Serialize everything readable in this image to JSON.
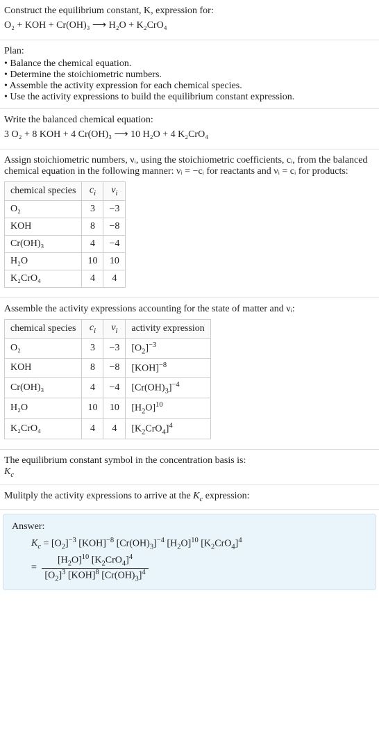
{
  "intro": {
    "line1": "Construct the equilibrium constant, K, expression for:",
    "equation": "O₂ + KOH + Cr(OH)₃ ⟶ H₂O + K₂CrO₄"
  },
  "plan": {
    "heading": "Plan:",
    "items": [
      "Balance the chemical equation.",
      "Determine the stoichiometric numbers.",
      "Assemble the activity expression for each chemical species.",
      "Use the activity expressions to build the equilibrium constant expression."
    ]
  },
  "balanced": {
    "heading": "Write the balanced chemical equation:",
    "equation": "3 O₂ + 8 KOH + 4 Cr(OH)₃ ⟶ 10 H₂O + 4 K₂CrO₄"
  },
  "stoich_intro": "Assign stoichiometric numbers, νᵢ, using the stoichiometric coefficients, cᵢ, from the balanced chemical equation in the following manner: νᵢ = −cᵢ for reactants and νᵢ = cᵢ for products:",
  "table1": {
    "headers": [
      "chemical species",
      "cᵢ",
      "νᵢ"
    ],
    "rows": [
      [
        "O₂",
        "3",
        "−3"
      ],
      [
        "KOH",
        "8",
        "−8"
      ],
      [
        "Cr(OH)₃",
        "4",
        "−4"
      ],
      [
        "H₂O",
        "10",
        "10"
      ],
      [
        "K₂CrO₄",
        "4",
        "4"
      ]
    ]
  },
  "activity_intro": "Assemble the activity expressions accounting for the state of matter and νᵢ:",
  "table2": {
    "headers": [
      "chemical species",
      "cᵢ",
      "νᵢ",
      "activity expression"
    ],
    "species": [
      "O₂",
      "KOH",
      "Cr(OH)₃",
      "H₂O",
      "K₂CrO₄"
    ],
    "ci": [
      "3",
      "8",
      "4",
      "10",
      "4"
    ],
    "vi": [
      "−3",
      "−8",
      "−4",
      "10",
      "4"
    ]
  },
  "symbol": {
    "line1": "The equilibrium constant symbol in the concentration basis is:",
    "line2": "K_c"
  },
  "multiply": "Mulitply the activity expressions to arrive at the K_c expression:",
  "answer": {
    "label": "Answer:"
  },
  "chart_data": {
    "type": "table",
    "tables": [
      {
        "title": "Stoichiometric numbers",
        "columns": [
          "chemical species",
          "c_i",
          "ν_i"
        ],
        "rows": [
          {
            "chemical species": "O₂",
            "c_i": 3,
            "ν_i": -3
          },
          {
            "chemical species": "KOH",
            "c_i": 8,
            "ν_i": -8
          },
          {
            "chemical species": "Cr(OH)₃",
            "c_i": 4,
            "ν_i": -4
          },
          {
            "chemical species": "H₂O",
            "c_i": 10,
            "ν_i": 10
          },
          {
            "chemical species": "K₂CrO₄",
            "c_i": 4,
            "ν_i": 4
          }
        ]
      },
      {
        "title": "Activity expressions",
        "columns": [
          "chemical species",
          "c_i",
          "ν_i",
          "activity expression"
        ],
        "rows": [
          {
            "chemical species": "O₂",
            "c_i": 3,
            "ν_i": -3,
            "activity expression": "[O₂]^(−3)"
          },
          {
            "chemical species": "KOH",
            "c_i": 8,
            "ν_i": -8,
            "activity expression": "[KOH]^(−8)"
          },
          {
            "chemical species": "Cr(OH)₃",
            "c_i": 4,
            "ν_i": -4,
            "activity expression": "[Cr(OH)₃]^(−4)"
          },
          {
            "chemical species": "H₂O",
            "c_i": 10,
            "ν_i": 10,
            "activity expression": "[H₂O]^(10)"
          },
          {
            "chemical species": "K₂CrO₄",
            "c_i": 4,
            "ν_i": 4,
            "activity expression": "[K₂CrO₄]^(4)"
          }
        ]
      }
    ],
    "equilibrium_constant": "K_c = [O₂]^(−3) [KOH]^(−8) [Cr(OH)₃]^(−4) [H₂O]^(10) [K₂CrO₄]^(4) = ([H₂O]^10 [K₂CrO₄]^4) / ([O₂]^3 [KOH]^8 [Cr(OH)₃]^4)"
  }
}
